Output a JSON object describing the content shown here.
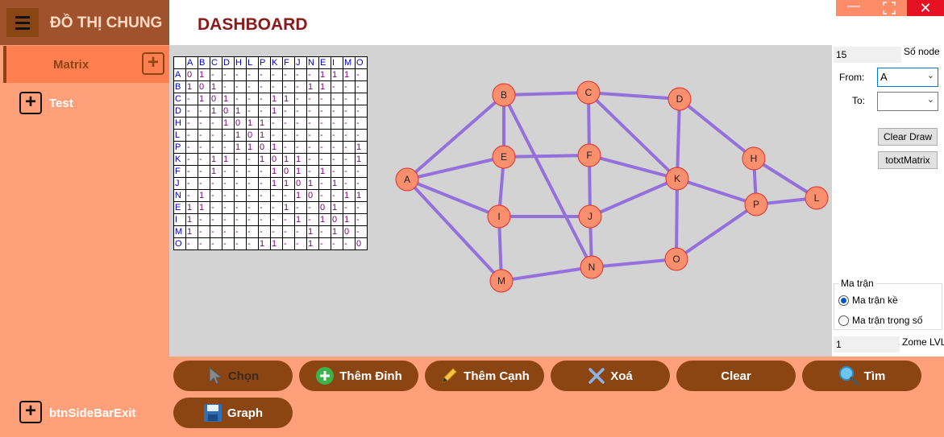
{
  "sidebar": {
    "title": "ĐỒ THỊ CHUNG",
    "matrix_label": "Matrix",
    "test_label": "Test",
    "exit_label": "btnSideBarExit"
  },
  "header": {
    "title": "DASHBOARD"
  },
  "matrix": {
    "columns": [
      "A",
      "B",
      "C",
      "D",
      "H",
      "L",
      "P",
      "K",
      "F",
      "J",
      "N",
      "E",
      "I",
      "M",
      "O"
    ],
    "rows": [
      {
        "label": "A",
        "cells": [
          "0",
          "1",
          "-",
          "-",
          "-",
          "-",
          "-",
          "-",
          "-",
          "-",
          "-",
          "1",
          "1",
          "1",
          "-"
        ]
      },
      {
        "label": "B",
        "cells": [
          "1",
          "0",
          "1",
          "-",
          "-",
          "-",
          "-",
          "-",
          "-",
          "-",
          "1",
          "1",
          "-",
          "-",
          "-"
        ]
      },
      {
        "label": "C",
        "cells": [
          "-",
          "1",
          "0",
          "1",
          "-",
          "-",
          "-",
          "1",
          "1",
          "-",
          "-",
          "-",
          "-",
          "-",
          "-"
        ]
      },
      {
        "label": "D",
        "cells": [
          "-",
          "-",
          "1",
          "0",
          "1",
          "-",
          "-",
          "1",
          "-",
          "-",
          "-",
          "-",
          "-",
          "-",
          "-"
        ]
      },
      {
        "label": "H",
        "cells": [
          "-",
          "-",
          "-",
          "1",
          "0",
          "1",
          "1",
          "-",
          "-",
          "-",
          "-",
          "-",
          "-",
          "-",
          "-"
        ]
      },
      {
        "label": "L",
        "cells": [
          "-",
          "-",
          "-",
          "-",
          "1",
          "0",
          "1",
          "-",
          "-",
          "-",
          "-",
          "-",
          "-",
          "-",
          "-"
        ]
      },
      {
        "label": "P",
        "cells": [
          "-",
          "-",
          "-",
          "-",
          "1",
          "1",
          "0",
          "1",
          "-",
          "-",
          "-",
          "-",
          "-",
          "-",
          "1"
        ]
      },
      {
        "label": "K",
        "cells": [
          "-",
          "-",
          "1",
          "1",
          "-",
          "-",
          "1",
          "0",
          "1",
          "1",
          "-",
          "-",
          "-",
          "-",
          "1"
        ]
      },
      {
        "label": "F",
        "cells": [
          "-",
          "-",
          "1",
          "-",
          "-",
          "-",
          "-",
          "1",
          "0",
          "1",
          "-",
          "1",
          "-",
          "-",
          "-"
        ]
      },
      {
        "label": "J",
        "cells": [
          "-",
          "-",
          "-",
          "-",
          "-",
          "-",
          "-",
          "1",
          "1",
          "0",
          "1",
          "-",
          "1",
          "-",
          "-"
        ]
      },
      {
        "label": "N",
        "cells": [
          "-",
          "1",
          "-",
          "-",
          "-",
          "-",
          "-",
          "-",
          "-",
          "1",
          "0",
          "-",
          "-",
          "1",
          "1"
        ]
      },
      {
        "label": "E",
        "cells": [
          "1",
          "1",
          "-",
          "-",
          "-",
          "-",
          "-",
          "-",
          "1",
          "-",
          "-",
          "0",
          "1",
          "-",
          "-"
        ]
      },
      {
        "label": "I",
        "cells": [
          "1",
          "-",
          "-",
          "-",
          "-",
          "-",
          "-",
          "-",
          "-",
          "1",
          "-",
          "1",
          "0",
          "1",
          "-"
        ]
      },
      {
        "label": "M",
        "cells": [
          "1",
          "-",
          "-",
          "-",
          "-",
          "-",
          "-",
          "-",
          "-",
          "-",
          "1",
          "-",
          "1",
          "0",
          "-"
        ]
      },
      {
        "label": "O",
        "cells": [
          "-",
          "-",
          "-",
          "-",
          "-",
          "-",
          "1",
          "1",
          "-",
          "-",
          "1",
          "-",
          "-",
          "-",
          "0"
        ]
      }
    ]
  },
  "graph": {
    "nodes": [
      "A",
      "B",
      "C",
      "D",
      "E",
      "F",
      "H",
      "I",
      "J",
      "K",
      "L",
      "M",
      "N",
      "O",
      "P"
    ],
    "edges": [
      [
        "A",
        "B"
      ],
      [
        "A",
        "E"
      ],
      [
        "A",
        "I"
      ],
      [
        "A",
        "M"
      ],
      [
        "B",
        "C"
      ],
      [
        "B",
        "E"
      ],
      [
        "B",
        "N"
      ],
      [
        "C",
        "D"
      ],
      [
        "C",
        "F"
      ],
      [
        "C",
        "K"
      ],
      [
        "D",
        "K"
      ],
      [
        "D",
        "H"
      ],
      [
        "E",
        "F"
      ],
      [
        "E",
        "I"
      ],
      [
        "F",
        "K"
      ],
      [
        "F",
        "J"
      ],
      [
        "I",
        "J"
      ],
      [
        "I",
        "M"
      ],
      [
        "J",
        "K"
      ],
      [
        "J",
        "N"
      ],
      [
        "K",
        "P"
      ],
      [
        "K",
        "O"
      ],
      [
        "H",
        "P"
      ],
      [
        "H",
        "L"
      ],
      [
        "P",
        "L"
      ],
      [
        "P",
        "O"
      ],
      [
        "M",
        "N"
      ],
      [
        "N",
        "O"
      ]
    ],
    "edge_color": "#9370db",
    "node_fill": "#fa8f6e",
    "node_stroke": "#e03030"
  },
  "panel": {
    "node_count": "15",
    "node_count_label": "Số node",
    "from_label": "From:",
    "from_value": "A",
    "to_label": "To:",
    "to_value": "",
    "clear_draw": "Clear Draw",
    "totxt_matrix": "totxtMatrix",
    "group_title": "Ma trận",
    "radio_adjacency": "Ma trận kề",
    "radio_weight": "Ma trận trọng số",
    "zoom_value": "1",
    "zoom_label": "Zome LVL"
  },
  "toolbar": {
    "select": "Chọn",
    "add_vertex": "Thêm Đỉnh",
    "add_edge": "Thêm Cạnh",
    "delete": "Xoá",
    "clear": "Clear",
    "find": "Tìm",
    "graph": "Graph"
  }
}
